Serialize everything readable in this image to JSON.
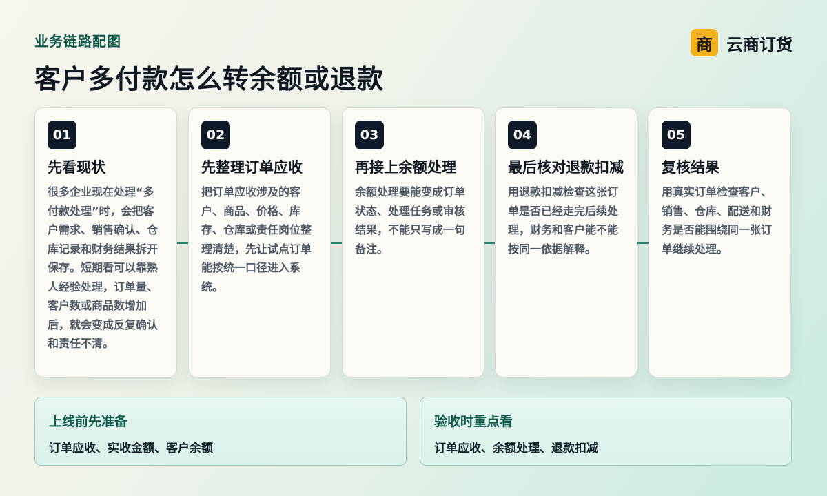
{
  "header": {
    "eyebrow": "业务链路配图",
    "title": "客户多付款怎么转余额或退款"
  },
  "brand": {
    "logo_char": "商",
    "name": "云商订货",
    "logo_color": "#f2b21d"
  },
  "steps": [
    {
      "num": "01",
      "title": "先看现状",
      "desc": "很多企业现在处理“多付款处理”时，会把客户需求、销售确认、仓库记录和财务结果拆开保存。短期看可以靠熟人经验处理，订单量、客户数或商品数增加后，就会变成反复确认和责任不清。"
    },
    {
      "num": "02",
      "title": "先整理订单应收",
      "desc": "把订单应收涉及的客户、商品、价格、库存、仓库或责任岗位整理清楚，先让试点订单能按统一口径进入系统。"
    },
    {
      "num": "03",
      "title": "再接上余额处理",
      "desc": "余额处理要能变成订单状态、处理任务或审核结果，不能只写成一句备注。"
    },
    {
      "num": "04",
      "title": "最后核对退款扣减",
      "desc": "用退款扣减检查这张订单是否已经走完后续处理，财务和客户能不能按同一依据解释。"
    },
    {
      "num": "05",
      "title": "复核结果",
      "desc": "用真实订单检查客户、销售、仓库、配送和财务是否能围绕同一张订单继续处理。"
    }
  ],
  "panels": {
    "left": {
      "title": "上线前先准备",
      "body": "订单应收、实收金额、客户余额"
    },
    "right": {
      "title": "验收时重点看",
      "body": "订单应收、余额处理、退款扣减"
    }
  },
  "colors": {
    "accent": "#0f5a48",
    "badge": "#0e1a28",
    "connector": "#2d8a76"
  }
}
